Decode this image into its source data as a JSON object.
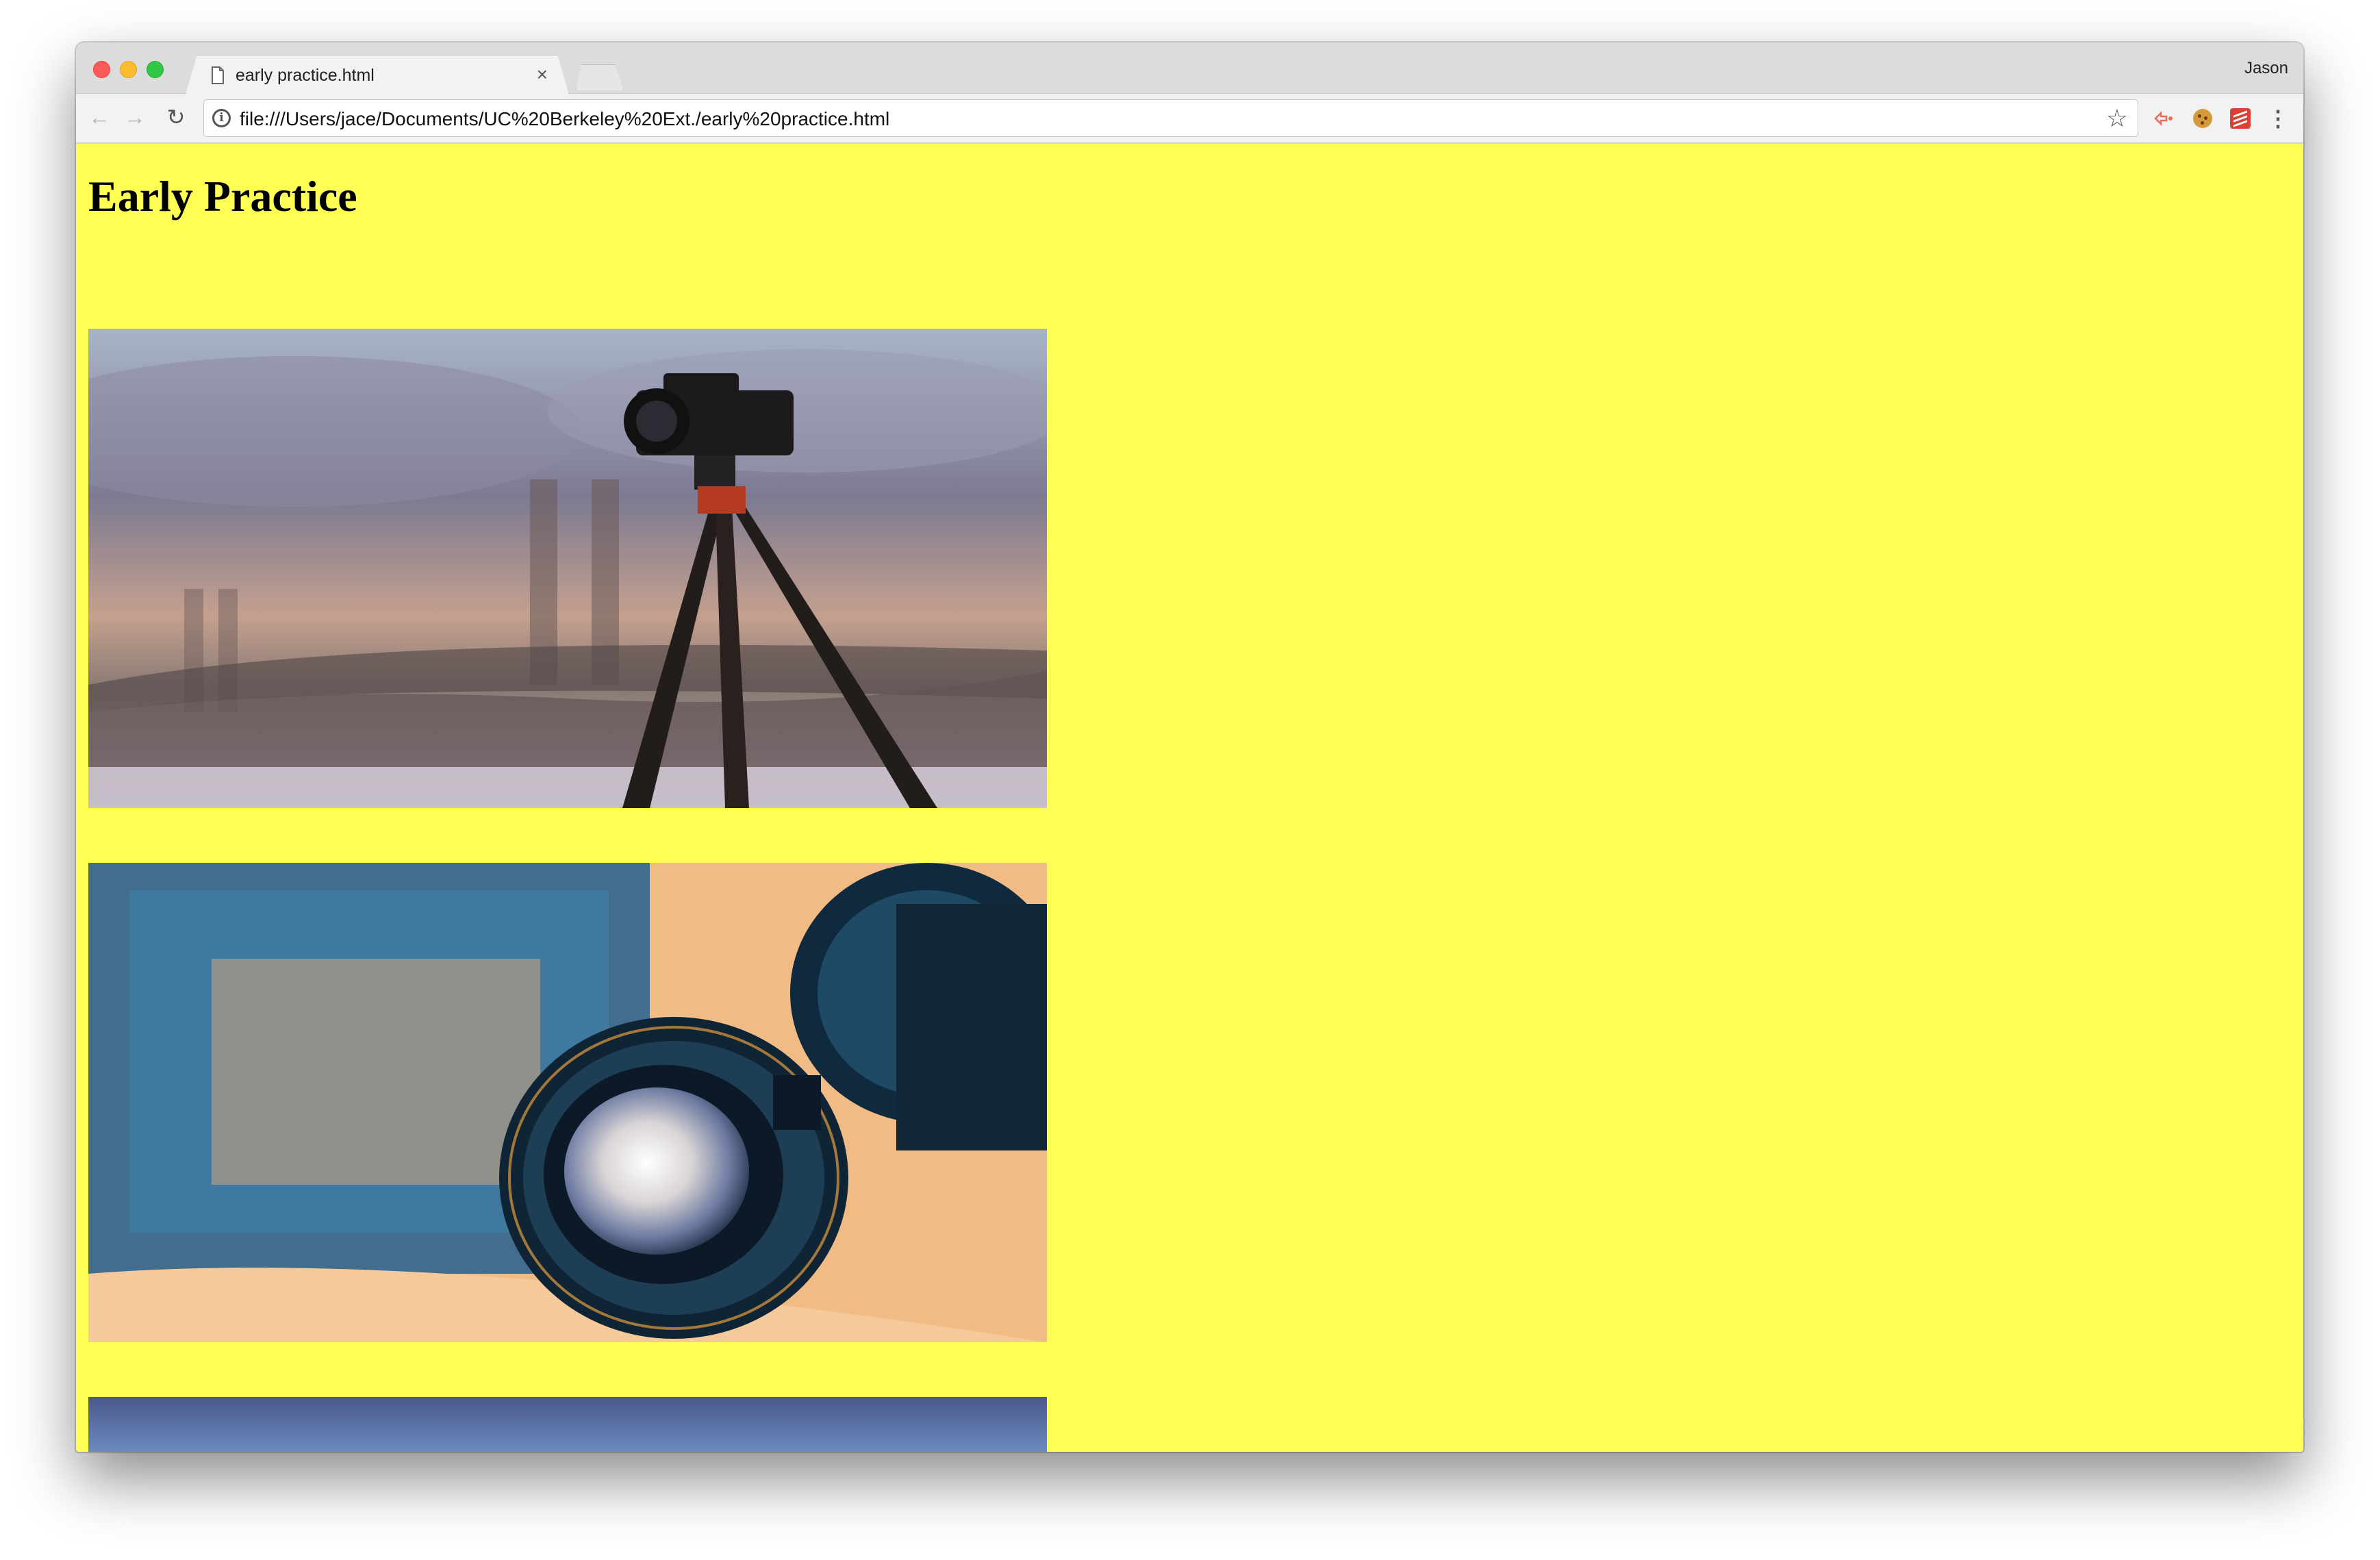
{
  "browser": {
    "tab": {
      "title": "early practice.html",
      "close_glyph": "×"
    },
    "profile_name": "Jason",
    "address_bar": {
      "url": "file:///Users/jace/Documents/UC%20Berkeley%20Ext./early%20practice.html"
    },
    "nav": {
      "back": "←",
      "forward": "→",
      "reload": "↻"
    },
    "star_glyph": "☆",
    "extensions": [
      "share-extension-icon",
      "cookie-extension-icon",
      "todoist-extension-icon"
    ],
    "menu_glyph": "⋮"
  },
  "page": {
    "title": "Early Practice",
    "background_color": "#fefe55",
    "images": [
      {
        "subject": "camera-on-tripod-golden-gate-bridge"
      },
      {
        "subject": "camera-lens-closeup"
      },
      {
        "subject": "partially-visible-image"
      }
    ]
  }
}
